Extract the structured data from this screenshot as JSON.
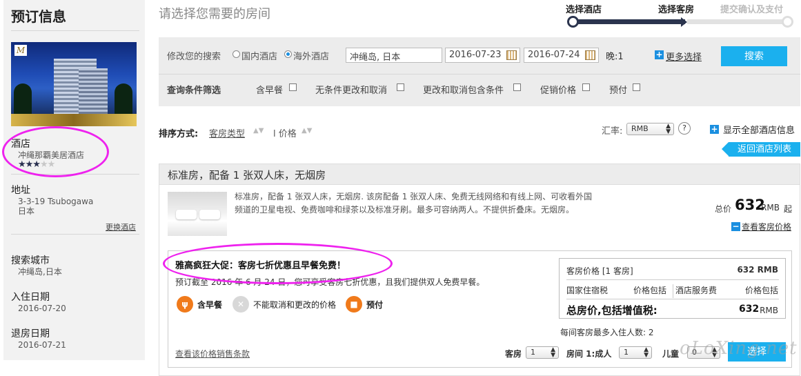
{
  "sidebar": {
    "title": "预订信息",
    "hotel_image_logo": "M",
    "hotel_label": "酒店",
    "hotel_name": "冲绳那覇美居酒店",
    "stars_on": "★★★",
    "stars_off": "★★",
    "star_rating": 3,
    "address_label": "地址",
    "address_line1": "3-3-19 Tsubogawa",
    "address_line2": "日本",
    "change_hotel": "更换酒店",
    "city_label": "搜索城市",
    "city_value": "冲绳岛,日本",
    "checkin_label": "入住日期",
    "checkin_value": "2016-07-20",
    "checkout_label": "退房日期",
    "checkout_value": "2016-07-21"
  },
  "header": {
    "title": "请选择您需要的房间",
    "steps": [
      "选择酒店",
      "选择客房",
      "提交确认及支付"
    ]
  },
  "search": {
    "modify_label": "修改您的搜索",
    "domestic": "国内酒店",
    "overseas": "海外酒店",
    "destination": "冲绳岛, 日本",
    "checkin": "2016-07-23",
    "checkout": "2016-07-24",
    "nights": "晚:1",
    "more_options": "更多选择",
    "search_button": "搜索",
    "filter_label": "查询条件筛选",
    "filters": [
      "含早餐",
      "无条件更改和取消",
      "更改和取消包含条件",
      "促销价格",
      "预付"
    ]
  },
  "sort": {
    "label": "排序方式:",
    "room_type": "客房类型",
    "arrows": "▲▼",
    "separator": "l",
    "price": "价格",
    "rate_label": "汇率:",
    "currency": "RMB",
    "help": "?",
    "show_all": "显示全部酒店信息",
    "back_to_list": "返回酒店列表"
  },
  "room": {
    "title": "标准房，配备 1 张双人床，无烟房",
    "desc_line1": "标准房，配备 1 张双人床，无烟房. 该房配备 1 张双人床、免费无线网络和有线上网、可收看外国",
    "desc_line2": "频道的卫星电视、免费咖啡和绿茶以及标准牙刷。最多可容纳两人。不提供折叠床。无烟房。",
    "total_label": "总价",
    "total_price": "632",
    "total_unit": "RMB",
    "total_from": "起",
    "view_prices": "查看客房价格",
    "offer": {
      "title": "雅高疯狂大促：客房七折优惠且早餐免费！",
      "desc": "预订截至 2016 年 6 月 24 日，您可享受客房七折优惠，且我们提供双人免费早餐。",
      "features": [
        "含早餐",
        "不能取消和更改的价格",
        "预付"
      ],
      "price_label": "客房价格 [1 客房]",
      "price_value": "632 RMB",
      "tax1_label": "国家住宿税",
      "tax1_value": "价格包括",
      "tax2_label": "酒店服务费",
      "tax2_value": "价格包括",
      "grand_label": "总房价,包括增值税:",
      "grand_value": "632",
      "grand_unit": "RMB",
      "max_occupancy": "每间客房最多入住人数: 2",
      "terms_link": "查看该价格销售条款",
      "rooms_label": "客房",
      "rooms_value": "1",
      "room1_label": "房间 1:成人",
      "adults_value": "1",
      "children_label": "儿童",
      "children_value": "0",
      "select_button": "选择"
    }
  },
  "colors": {
    "accent": "#1bb0ee",
    "annotation": "#ee22ee",
    "dark_track": "#2b344e"
  },
  "watermark": "oLoXing.net"
}
